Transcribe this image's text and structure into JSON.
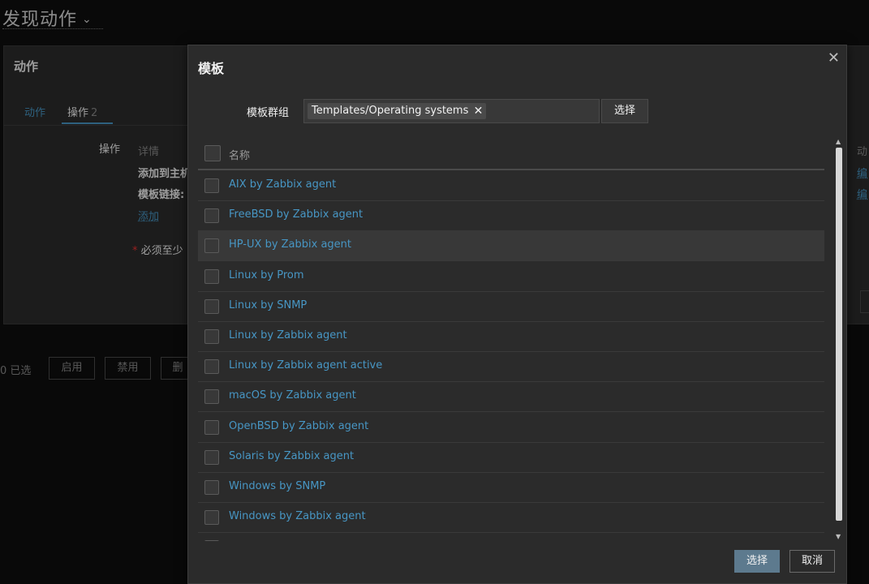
{
  "page": {
    "title": "发现动作"
  },
  "background": {
    "panel_title": "动作",
    "tabs": [
      {
        "label": "动作"
      },
      {
        "label": "操作",
        "count": "2"
      }
    ],
    "operations_label": "操作",
    "details_label": "详情",
    "op_line1": "添加到主机",
    "op_line2": "模板链接:",
    "add_link": "添加",
    "required_note": "必须至少",
    "selected_count": "0 已选",
    "btn_enable": "启用",
    "btn_disable": "禁用",
    "btn_delete": "删",
    "right_col_header": "动",
    "right_link1": "编",
    "right_link2": "编"
  },
  "modal": {
    "title": "模板",
    "filter": {
      "label": "模板群组",
      "chip": "Templates/Operating systems",
      "select_button": "选择"
    },
    "list": {
      "header": "名称",
      "items": [
        {
          "name": "AIX by Zabbix agent"
        },
        {
          "name": "FreeBSD by Zabbix agent"
        },
        {
          "name": "HP-UX by Zabbix agent"
        },
        {
          "name": "Linux by Prom"
        },
        {
          "name": "Linux by SNMP"
        },
        {
          "name": "Linux by Zabbix agent"
        },
        {
          "name": "Linux by Zabbix agent active"
        },
        {
          "name": "macOS by Zabbix agent"
        },
        {
          "name": "OpenBSD by Zabbix agent"
        },
        {
          "name": "Solaris by Zabbix agent"
        },
        {
          "name": "Windows by SNMP"
        },
        {
          "name": "Windows by Zabbix agent"
        }
      ]
    },
    "buttons": {
      "select": "选择",
      "cancel": "取消"
    }
  },
  "icons": {
    "close": "close-icon",
    "chip_remove": "remove-icon",
    "dropdown": "chevron-down-icon",
    "scroll_up": "scroll-up-icon",
    "scroll_down": "scroll-down-icon"
  },
  "colors": {
    "link": "#4796c4",
    "primary_button": "#5d7a8e",
    "panel_bg": "#2b2b2b"
  }
}
